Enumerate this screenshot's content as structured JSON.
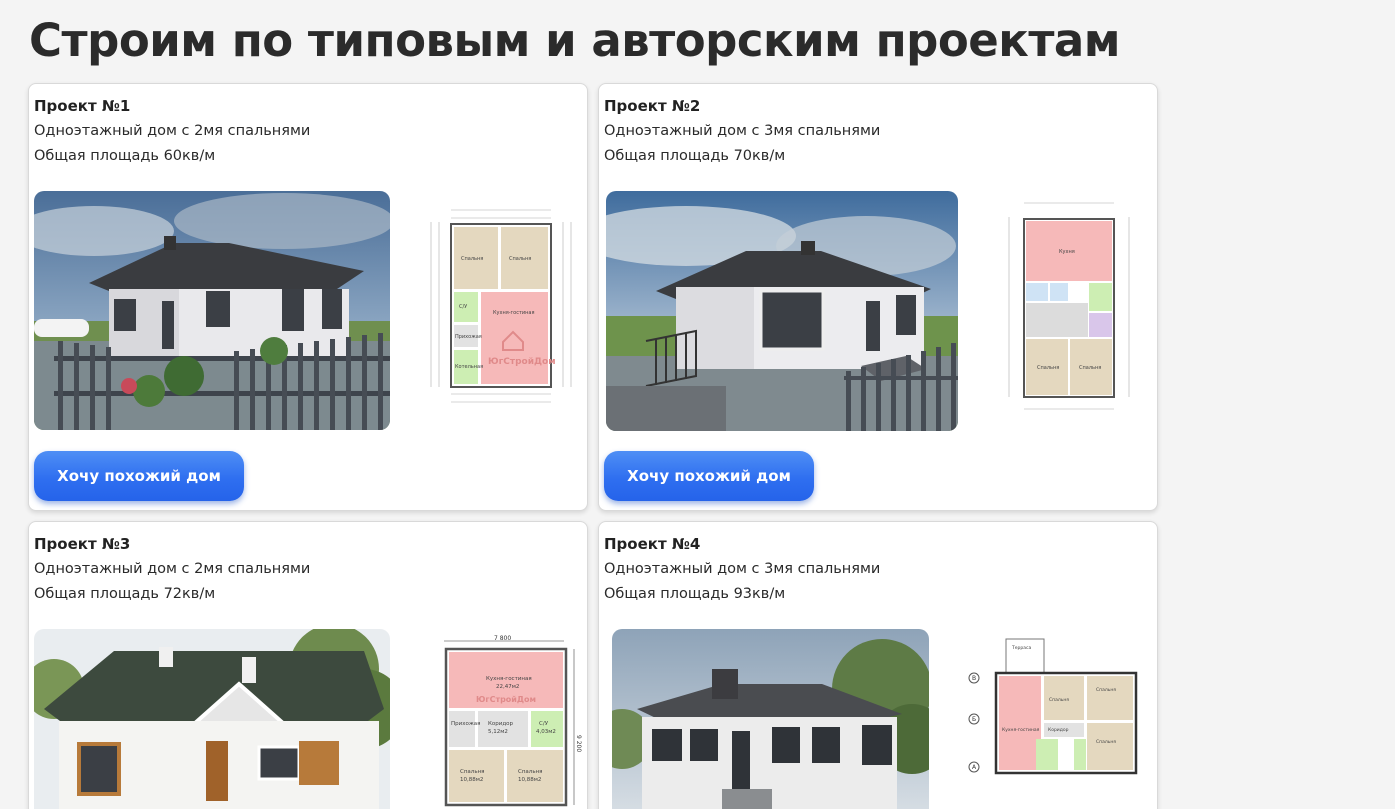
{
  "page": {
    "title": "Строим по типовым и авторским проектам"
  },
  "projects": [
    {
      "title": "Проект №1",
      "description": "Одноэтажный дом с 2мя спальнями",
      "area": "Общая площадь 60кв/м",
      "button_label": "Хочу похожий дом",
      "plan_labels": [
        "Спальня",
        "Спальня",
        "С/У",
        "Кухня-гостиная",
        "Прихожая",
        "Котельная"
      ],
      "watermark": "ЮгСтройДом"
    },
    {
      "title": "Проект №2",
      "description": "Одноэтажный дом с 3мя спальнями",
      "area": "Общая площадь 70кв/м",
      "button_label": "Хочу похожий дом",
      "plan_labels": [
        "Кухня",
        "Спальня",
        "Спальня"
      ]
    },
    {
      "title": "Проект №3",
      "description": "Одноэтажный дом с 2мя спальнями",
      "area": "Общая площадь 72кв/м",
      "plan_labels": [
        "Кухня-гостиная",
        "22,47м2",
        "Прихожая",
        "Коридор",
        "5,12м2",
        "С/У",
        "4,03м2",
        "Спальня",
        "10,88м2",
        "Спальня",
        "10,88м2",
        "7 800",
        "9 200"
      ],
      "watermark": "ЮгСтройДом"
    },
    {
      "title": "Проект №4",
      "description": "Одноэтажный дом с 3мя спальнями",
      "area": "Общая площадь 93кв/м",
      "plan_labels": [
        "Терраса",
        "Спальня",
        "Спальня",
        "Кухня-гостиная",
        "Коридор",
        "Спальня",
        "В",
        "Б",
        "А"
      ]
    }
  ],
  "colors": {
    "button": "#2f6ff0",
    "plan_pink": "#f6b9b9",
    "plan_beige": "#e8dcc4",
    "plan_green": "#cdeeb3"
  }
}
